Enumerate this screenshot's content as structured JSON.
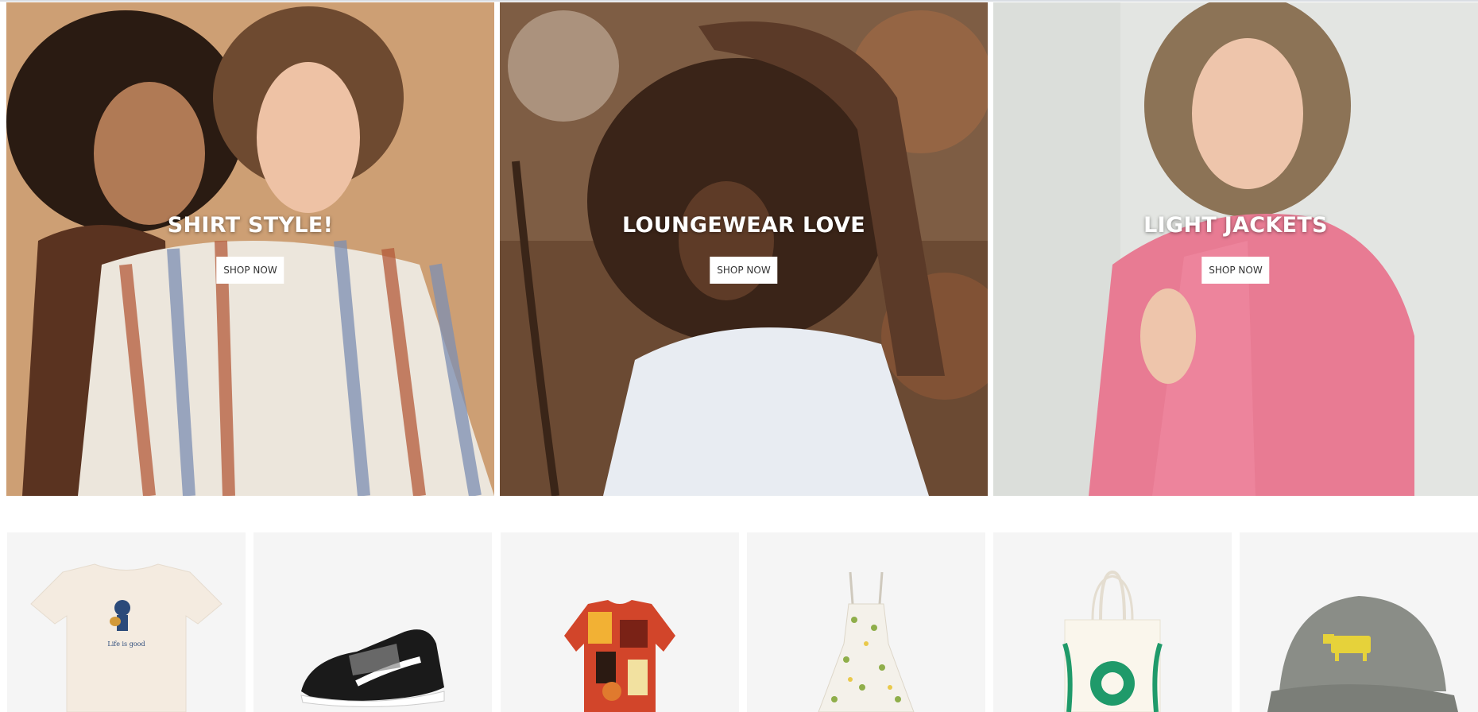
{
  "heroes": [
    {
      "title": "SHIRT STYLE!",
      "button": "SHOP NOW"
    },
    {
      "title": "LOUNGEWEAR LOVE",
      "button": "SHOP NOW"
    },
    {
      "title": "LIGHT JACKETS",
      "button": "SHOP NOW"
    }
  ],
  "products": [
    {
      "name": "tee-shirt",
      "image_text": "Life is good"
    },
    {
      "name": "sneaker"
    },
    {
      "name": "printed-shirt"
    },
    {
      "name": "floral-dress"
    },
    {
      "name": "tote-bag"
    },
    {
      "name": "cap"
    }
  ],
  "colors": {
    "hero1_bg": "#c99a6e",
    "hero2_bg": "#6b4a33",
    "hero3_bg": "#e3e5e2",
    "card_bg": "#f5f5f5",
    "button_text": "#333333"
  }
}
